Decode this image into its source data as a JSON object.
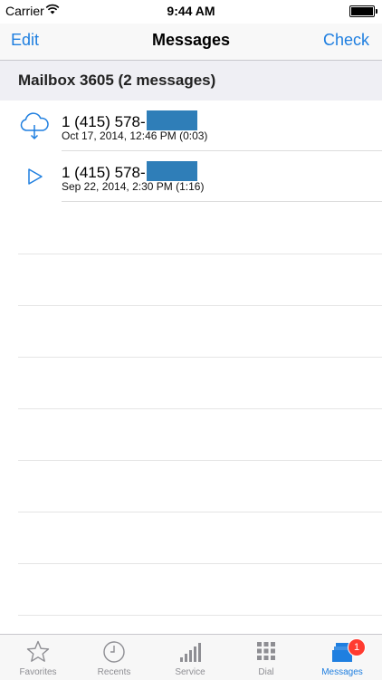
{
  "status_bar": {
    "carrier": "Carrier",
    "time": "9:44 AM"
  },
  "nav": {
    "left_label": "Edit",
    "title": "Messages",
    "right_label": "Check"
  },
  "section_header": "Mailbox 3605 (2 messages)",
  "messages": [
    {
      "phone": "1 (415) 578-",
      "meta": "Oct 17, 2014, 12:46 PM (0:03)",
      "icon": "cloud-download-icon"
    },
    {
      "phone": "1 (415) 578-",
      "meta": "Sep 22, 2014, 2:30 PM (1:16)",
      "icon": "play-icon"
    }
  ],
  "tab_bar": {
    "tabs": [
      {
        "label": "Favorites",
        "icon": "star-icon"
      },
      {
        "label": "Recents",
        "icon": "clock-icon"
      },
      {
        "label": "Service",
        "icon": "signal-bars-icon"
      },
      {
        "label": "Dial",
        "icon": "keypad-icon"
      },
      {
        "label": "Messages",
        "icon": "voicemail-stack-icon",
        "badge": "1"
      }
    ],
    "active": "Messages"
  },
  "colors": {
    "accent": "#1f7fe0",
    "redaction": "#2f7eb8",
    "badge": "#ff3b30"
  }
}
